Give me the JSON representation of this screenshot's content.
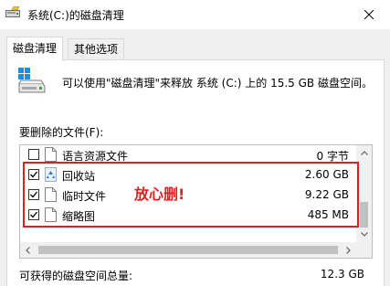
{
  "window": {
    "title": "系统(C:)的磁盘清理"
  },
  "tabs": [
    {
      "label": "磁盘清理",
      "active": true
    },
    {
      "label": "其他选项",
      "active": false
    }
  ],
  "main": {
    "info_text": "可以使用\"磁盘清理\"来释放 系统 (C:) 上的 15.5 GB 磁盘空间。",
    "files_label": "要删除的文件(F):",
    "files": [
      {
        "name": "语言资源文件",
        "size": "0 字节",
        "checked": false,
        "icon": "file-icon"
      },
      {
        "name": "回收站",
        "size": "2.60 GB",
        "checked": true,
        "icon": "recycle-bin-icon"
      },
      {
        "name": "临时文件",
        "size": "9.22 GB",
        "checked": true,
        "icon": "file-icon"
      },
      {
        "name": "缩略图",
        "size": "485 MB",
        "checked": true,
        "icon": "file-icon"
      }
    ],
    "annotation": "放心删!",
    "total_label": "可获得的磁盘空间总量:",
    "total_value": "12.3 GB"
  },
  "colors": {
    "annotation": "#e31e1e",
    "accent": "#0078d7"
  }
}
